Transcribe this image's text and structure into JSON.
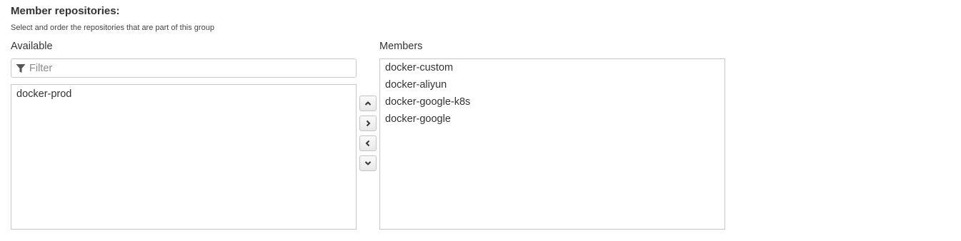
{
  "section": {
    "title": "Member repositories:",
    "description": "Select and order the repositories that are part of this group"
  },
  "available": {
    "label": "Available",
    "filter_placeholder": "Filter",
    "filter_value": "",
    "items": [
      {
        "label": "docker-prod"
      }
    ]
  },
  "members": {
    "label": "Members",
    "items": [
      {
        "label": "docker-custom"
      },
      {
        "label": "docker-aliyun"
      },
      {
        "label": "docker-google-k8s"
      },
      {
        "label": "docker-google"
      }
    ]
  },
  "buttons": [
    {
      "icon": "chevron-up-icon"
    },
    {
      "icon": "chevron-right-icon"
    },
    {
      "icon": "chevron-left-icon"
    },
    {
      "icon": "chevron-down-icon"
    }
  ],
  "colors": {
    "border": "#c8c8c8",
    "text": "#333333",
    "placeholder": "#8a8a8a"
  }
}
